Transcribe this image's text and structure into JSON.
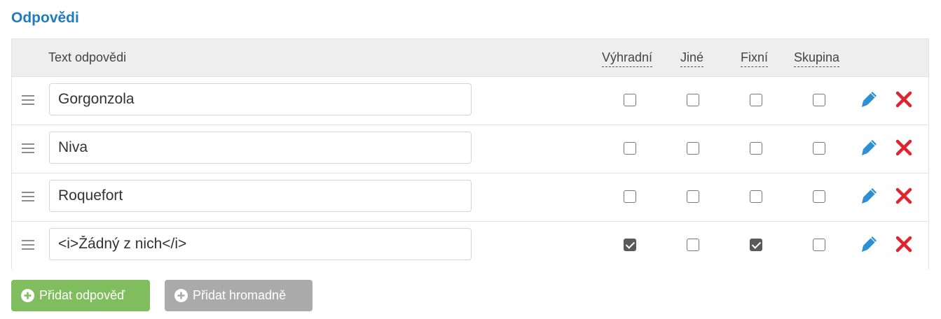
{
  "section": {
    "title": "Odpovědi"
  },
  "table": {
    "headers": {
      "text": "Text odpovědi",
      "exclusive": "Výhradní",
      "other": "Jiné",
      "fixed": "Fixní",
      "group": "Skupina"
    },
    "rows": [
      {
        "value": "Gorgonzola",
        "exclusive": false,
        "other": false,
        "fixed": false,
        "group": false
      },
      {
        "value": "Niva",
        "exclusive": false,
        "other": false,
        "fixed": false,
        "group": false
      },
      {
        "value": "Roquefort",
        "exclusive": false,
        "other": false,
        "fixed": false,
        "group": false
      },
      {
        "value": "<i>Žádný z nich</i>",
        "exclusive": true,
        "other": false,
        "fixed": true,
        "group": false
      }
    ]
  },
  "buttons": {
    "add_answer": "Přidat odpověď",
    "add_bulk": "Přidat hromadně"
  },
  "icons": {
    "drag": "drag-handle-icon",
    "edit": "pencil-icon",
    "delete": "close-icon",
    "add": "plus-circle-icon"
  },
  "colors": {
    "title": "#1f7dbd",
    "primary_button": "#7fbd5f",
    "secondary_button": "#aaaaaa",
    "edit_icon": "#2c8fd1",
    "delete_icon": "#e0242f",
    "header_background": "#eeeeee"
  }
}
